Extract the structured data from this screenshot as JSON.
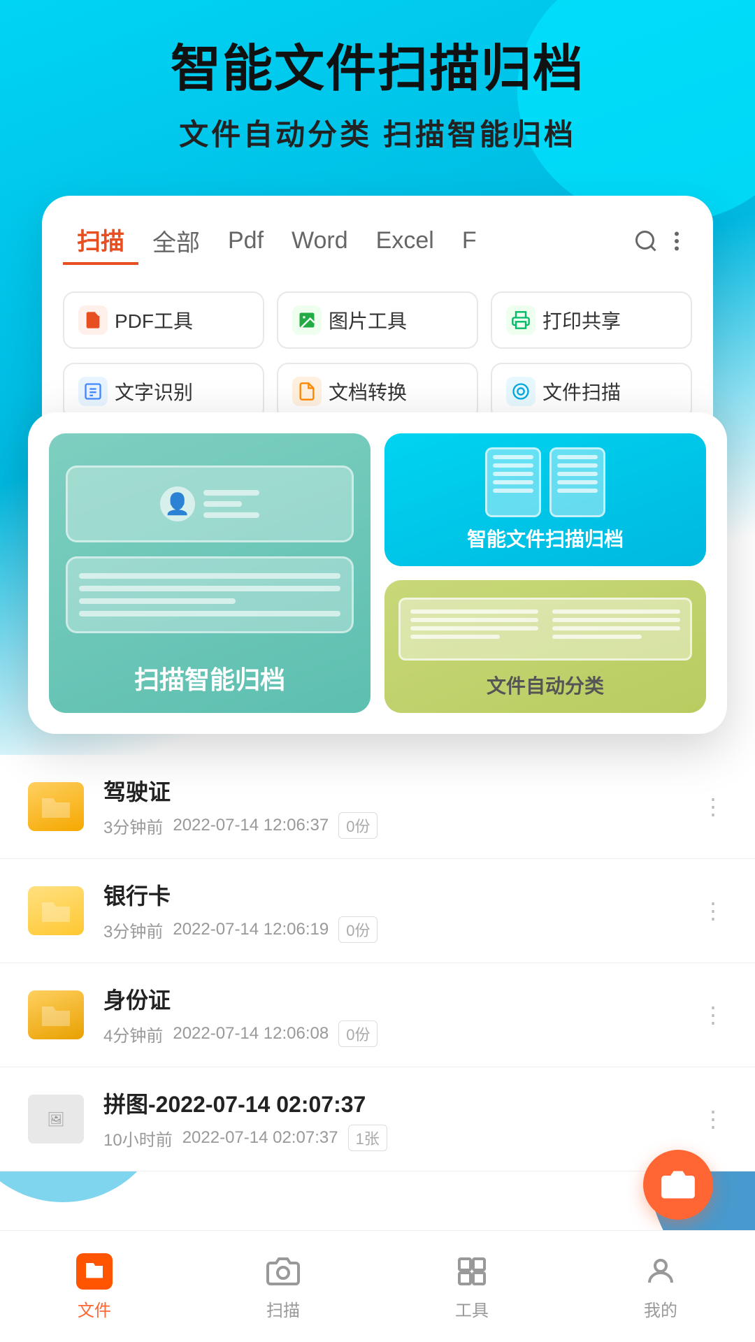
{
  "app": {
    "title": "智能文件扫描归档",
    "subtitle": "文件自动分类   扫描智能归档"
  },
  "tabs": {
    "items": [
      {
        "label": "扫描",
        "active": true
      },
      {
        "label": "全部",
        "active": false
      },
      {
        "label": "Pdf",
        "active": false
      },
      {
        "label": "Word",
        "active": false
      },
      {
        "label": "Excel",
        "active": false
      },
      {
        "label": "F",
        "active": false
      }
    ]
  },
  "tools": {
    "row1": [
      {
        "icon": "PDF",
        "label": "PDF工具"
      },
      {
        "icon": "IMG",
        "label": "图片工具"
      },
      {
        "icon": "PRT",
        "label": "打印共享"
      }
    ],
    "row2": [
      {
        "icon": "TXT",
        "label": "文字识别"
      },
      {
        "icon": "DOC",
        "label": "文档转换"
      },
      {
        "icon": "SCN",
        "label": "文件扫描"
      }
    ]
  },
  "features": {
    "left": {
      "label": "扫描智能归档"
    },
    "right_top": {
      "label": "智能文件扫描归档"
    },
    "right_bottom": {
      "label": "文件自动分类"
    }
  },
  "files": [
    {
      "name": "驾驶证",
      "time_ago": "3分钟前",
      "date": "2022-07-14 12:06:37",
      "count": "0份",
      "type": "folder"
    },
    {
      "name": "银行卡",
      "time_ago": "3分钟前",
      "date": "2022-07-14 12:06:19",
      "count": "0份",
      "type": "folder"
    },
    {
      "name": "身份证",
      "time_ago": "4分钟前",
      "date": "2022-07-14 12:06:08",
      "count": "0份",
      "type": "folder"
    },
    {
      "name": "拼图-2022-07-14 02:07:37",
      "time_ago": "10小时前",
      "date": "2022-07-14 02:07:37",
      "count": "1张",
      "type": "image"
    }
  ],
  "bottom_nav": [
    {
      "label": "文件",
      "active": true,
      "icon": "files"
    },
    {
      "label": "扫描",
      "active": false,
      "icon": "scan"
    },
    {
      "label": "工具",
      "active": false,
      "icon": "tools"
    },
    {
      "label": "我的",
      "active": false,
      "icon": "profile"
    }
  ]
}
